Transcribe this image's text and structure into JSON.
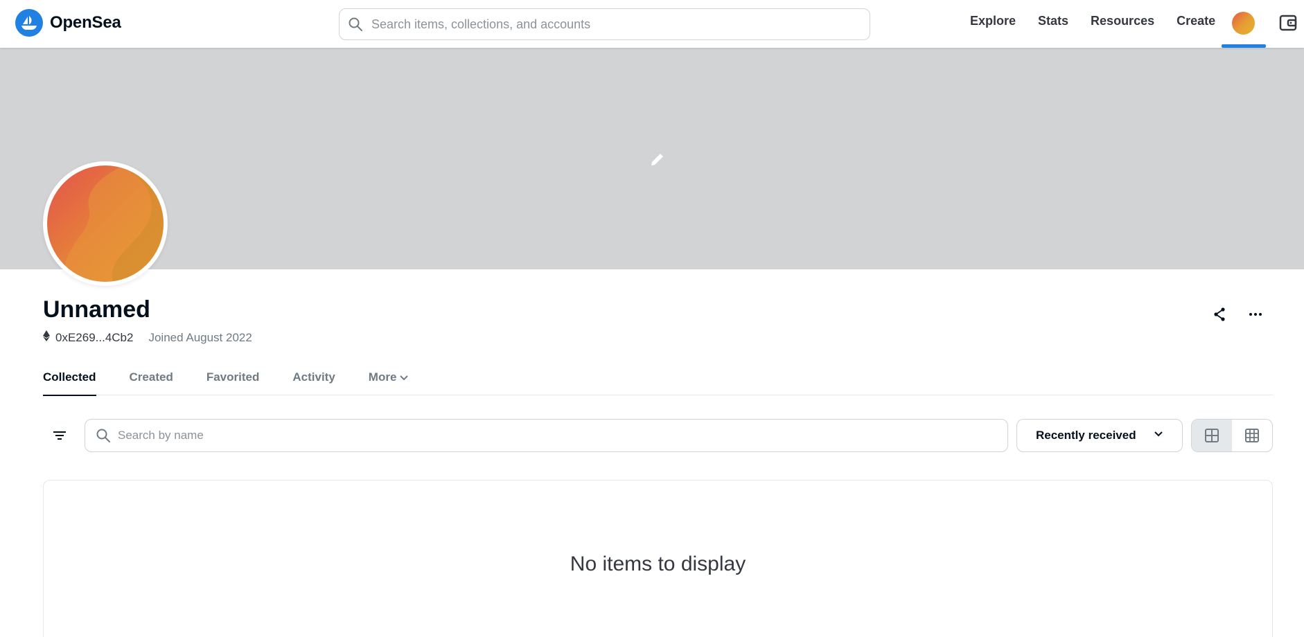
{
  "header": {
    "logo_text": "OpenSea",
    "search_placeholder": "Search items, collections, and accounts",
    "nav": [
      "Explore",
      "Stats",
      "Resources",
      "Create"
    ],
    "brand_color": "#2081e2"
  },
  "profile": {
    "name": "Unnamed",
    "address": "0xE269...4Cb2",
    "joined": "Joined August 2022"
  },
  "tabs": [
    {
      "label": "Collected",
      "active": true
    },
    {
      "label": "Created",
      "active": false
    },
    {
      "label": "Favorited",
      "active": false
    },
    {
      "label": "Activity",
      "active": false
    },
    {
      "label": "More",
      "active": false
    }
  ],
  "filters": {
    "search_placeholder": "Search by name",
    "sort_label": "Recently received"
  },
  "empty": {
    "message": "No items to display"
  },
  "icons": {
    "logo": "opensea-ship-icon",
    "search": "search-icon",
    "wallet": "wallet-icon",
    "edit": "pencil-icon",
    "share": "share-icon",
    "more": "more-dots-icon",
    "filter": "filter-icon",
    "grid_large": "grid-large-icon",
    "grid_small": "grid-small-icon"
  }
}
